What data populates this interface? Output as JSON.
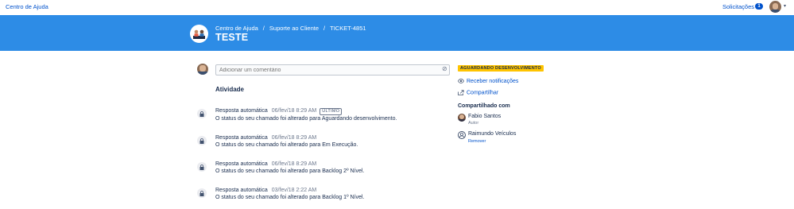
{
  "topbar": {
    "brand": "Centro de Ajuda",
    "requests_label": "Solicitações",
    "requests_count": "1"
  },
  "header": {
    "breadcrumb": [
      "Centro de Ajuda",
      "Suporte ao Cliente",
      "TICKET-4851"
    ],
    "separator": "/",
    "title": "TESTE"
  },
  "comment": {
    "placeholder": "Adicionar um comentário"
  },
  "activity": {
    "title": "Atividade",
    "items": [
      {
        "author": "Resposta automática",
        "date": "06/fev/18 8:29 AM",
        "badge": "ÚLTIMO",
        "text": "O status do seu chamado foi alterado para Aguardando desenvolvimento."
      },
      {
        "author": "Resposta automática",
        "date": "06/fev/18 8:29 AM",
        "badge": "",
        "text": "O status do seu chamado foi alterado para Em Execução."
      },
      {
        "author": "Resposta automática",
        "date": "06/fev/18 8:29 AM",
        "badge": "",
        "text": "O status do seu chamado foi alterado para Backlog 2º Nível."
      },
      {
        "author": "Resposta automática",
        "date": "03/fev/18 2:22 AM",
        "badge": "",
        "text": "O status do seu chamado foi alterado para Backlog 1º Nível."
      }
    ]
  },
  "sidebar": {
    "status": "AGUARDANDO DESENVOLVIMENTO",
    "status_color": "#ffc400",
    "notify_label": "Receber notificações",
    "notify_icon": "eye-icon",
    "share_label": "Compartilhar",
    "share_icon": "share-icon",
    "shared_title": "Compartilhado com",
    "people": [
      {
        "name": "Fabio Santos",
        "sub": "Autor"
      },
      {
        "name": "Raimundo Veículos",
        "sub": "Remover"
      }
    ]
  },
  "colors": {
    "header_blue": "#2d8ce6",
    "link_blue": "#0052cc"
  }
}
